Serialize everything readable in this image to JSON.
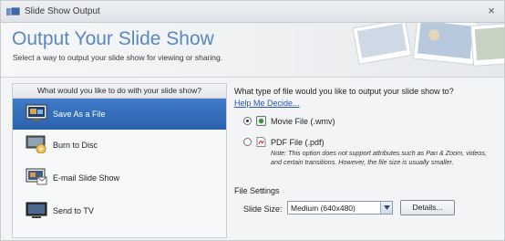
{
  "window": {
    "title": "Slide Show Output",
    "close": "×"
  },
  "header": {
    "title": "Output Your Slide Show",
    "subtitle": "Select a way to output your slide show for viewing or sharing."
  },
  "left_panel": {
    "header": "What would you like to do with your slide show?",
    "options": [
      {
        "label": "Save As a File",
        "icon": "save-file-icon",
        "selected": true
      },
      {
        "label": "Burn to Disc",
        "icon": "disc-icon",
        "selected": false
      },
      {
        "label": "E-mail Slide Show",
        "icon": "email-icon",
        "selected": false
      },
      {
        "label": "Send to TV",
        "icon": "tv-icon",
        "selected": false
      }
    ]
  },
  "right_panel": {
    "question": "What type of file would you like to output your slide show to?",
    "help_link": "Help Me Decide...",
    "file_types": [
      {
        "label": "Movie File (.wmv)",
        "selected": true,
        "icon": "movie-file-icon"
      },
      {
        "label": "PDF File (.pdf)",
        "selected": false,
        "icon": "pdf-file-icon"
      }
    ],
    "note": "Note: This option does not support attributes such as Pan & Zoom, videos, and certain transitions. However, the file size is usually smaller.",
    "file_settings": {
      "title": "File Settings",
      "slide_size_label": "Slide Size:",
      "slide_size_value": "Medium (640x480)",
      "details_button": "Details..."
    }
  },
  "colors": {
    "accent": "#5a87c0",
    "selection": "#2f6ab8",
    "link": "#2a55b5"
  }
}
